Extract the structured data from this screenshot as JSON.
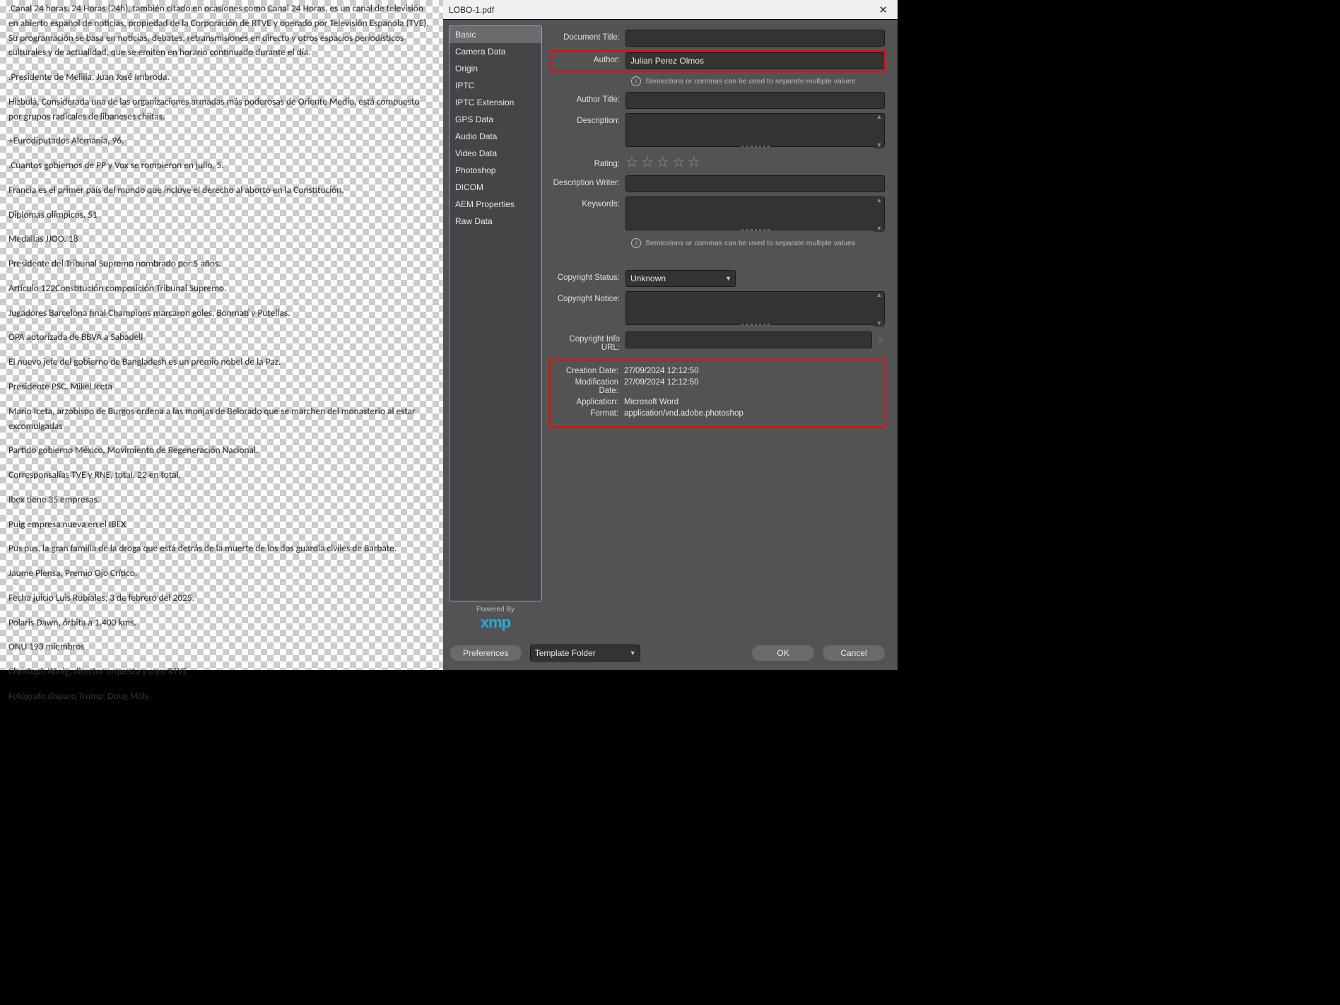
{
  "titlebar": {
    "filename": "LOBO-1.pdf"
  },
  "nav": {
    "items": [
      "Basic",
      "Camera Data",
      "Origin",
      "IPTC",
      "IPTC Extension",
      "GPS Data",
      "Audio Data",
      "Video Data",
      "Photoshop",
      "DICOM",
      "AEM Properties",
      "Raw Data"
    ],
    "selected": 0
  },
  "labels": {
    "document_title": "Document Title:",
    "author": "Author:",
    "author_title": "Author Title:",
    "description": "Description:",
    "rating": "Rating:",
    "description_writer": "Description Writer:",
    "keywords": "Keywords:",
    "copyright_status": "Copyright Status:",
    "copyright_notice": "Copyright Notice:",
    "copyright_info_url": "Copyright Info URL:",
    "creation_date": "Creation Date:",
    "modification_date": "Modification Date:",
    "application": "Application:",
    "format": "Format:"
  },
  "values": {
    "document_title": "",
    "author": "Julian Perez Olmos",
    "author_title": "",
    "description": "",
    "description_writer": "",
    "keywords": "",
    "copyright_status": "Unknown",
    "copyright_notice": "",
    "copyright_info_url": "",
    "creation_date": "27/09/2024 12:12:50",
    "modification_date": "27/09/2024 12:12:50",
    "application": "Microsoft Word",
    "format": "application/vnd.adobe.photoshop"
  },
  "hints": {
    "separator": "Semicolons or commas can be used to separate multiple values"
  },
  "powered": {
    "label": "Powered By",
    "logo": "xmp"
  },
  "footer": {
    "preferences": "Preferences",
    "template_folder": "Template Folder",
    "ok": "OK",
    "cancel": "Cancel"
  },
  "canvas_text": [
    ".Canal 24 horas. 24 Horas (24h), también citado en ocasiones como Canal 24 Horas, es un canal de televisión en abierto español de noticias, propiedad de la Corporación de RTVE y operado por Televisión Española (TVE). Su programación se basa en noticias, debates, retransmisiones en directo y otros espacios periodísticos culturales y de actualidad, que se emiten en horario continuado durante el día.",
    ".Presidente de Melilla, Juan José Imbroda.",
    "Hizbulá, Considerada una de las organizaciones armadas más poderosas de Oriente Medio, está compuesto por grupos radicales de libaneses chiitas.",
    "+Eurodiputados Alemania, 96.",
    ".Cuantos gobiernos de PP y Vox se rompieron en julio, 5.",
    "Francia es el primer país del mundo que incluye el derecho al aborto en la Constitución.",
    "Diplomas olímpicos. 51",
    "Medallas JJOO. 18",
    "Presidente del Tribunal Supremo nombrado por 5 años.",
    "Artículo 122Constitución composición Tribunal Supremo.",
    "Jugadores Barcelona final Champions marcaron goles, Bonmatí y Putellas.",
    "OPA autorizada de BBVA a Sabadell",
    "El nuevo jefe del gobierno de Bangladesh es un premio nobel de la Paz.",
    "Presidente PSC. Mikel Iceta",
    "Mario Iceta, arzobispo de Burgos ordena a las monjas de Belorado que se marchen del monasterio al estar excomulgadas",
    "Partido gobierno México, Movimiento de Regeneración Nacional.",
    "Corresponsalías TVE y RNE, total. 22 en total.",
    "Ibex tiene 35 empresas.",
    "Puig empresa nueva en el IBEX",
    "Pus pus, la gran familia de la droga que está detrás de la muerte de los dos guardia civiles de Barbate.",
    "Jaume Plensa, Premio Ojo Crítico.",
    "Fecha juicio Luis Rubiales, 3 de febrero del 2025.",
    "Polaris Dawn, órbita a 1.400 kms.",
    "ONU 193 miembros",
    "Christoph König, director orquesta y coro RTVE",
    "Fotógrafo disparo Trump, Doug Mills"
  ]
}
